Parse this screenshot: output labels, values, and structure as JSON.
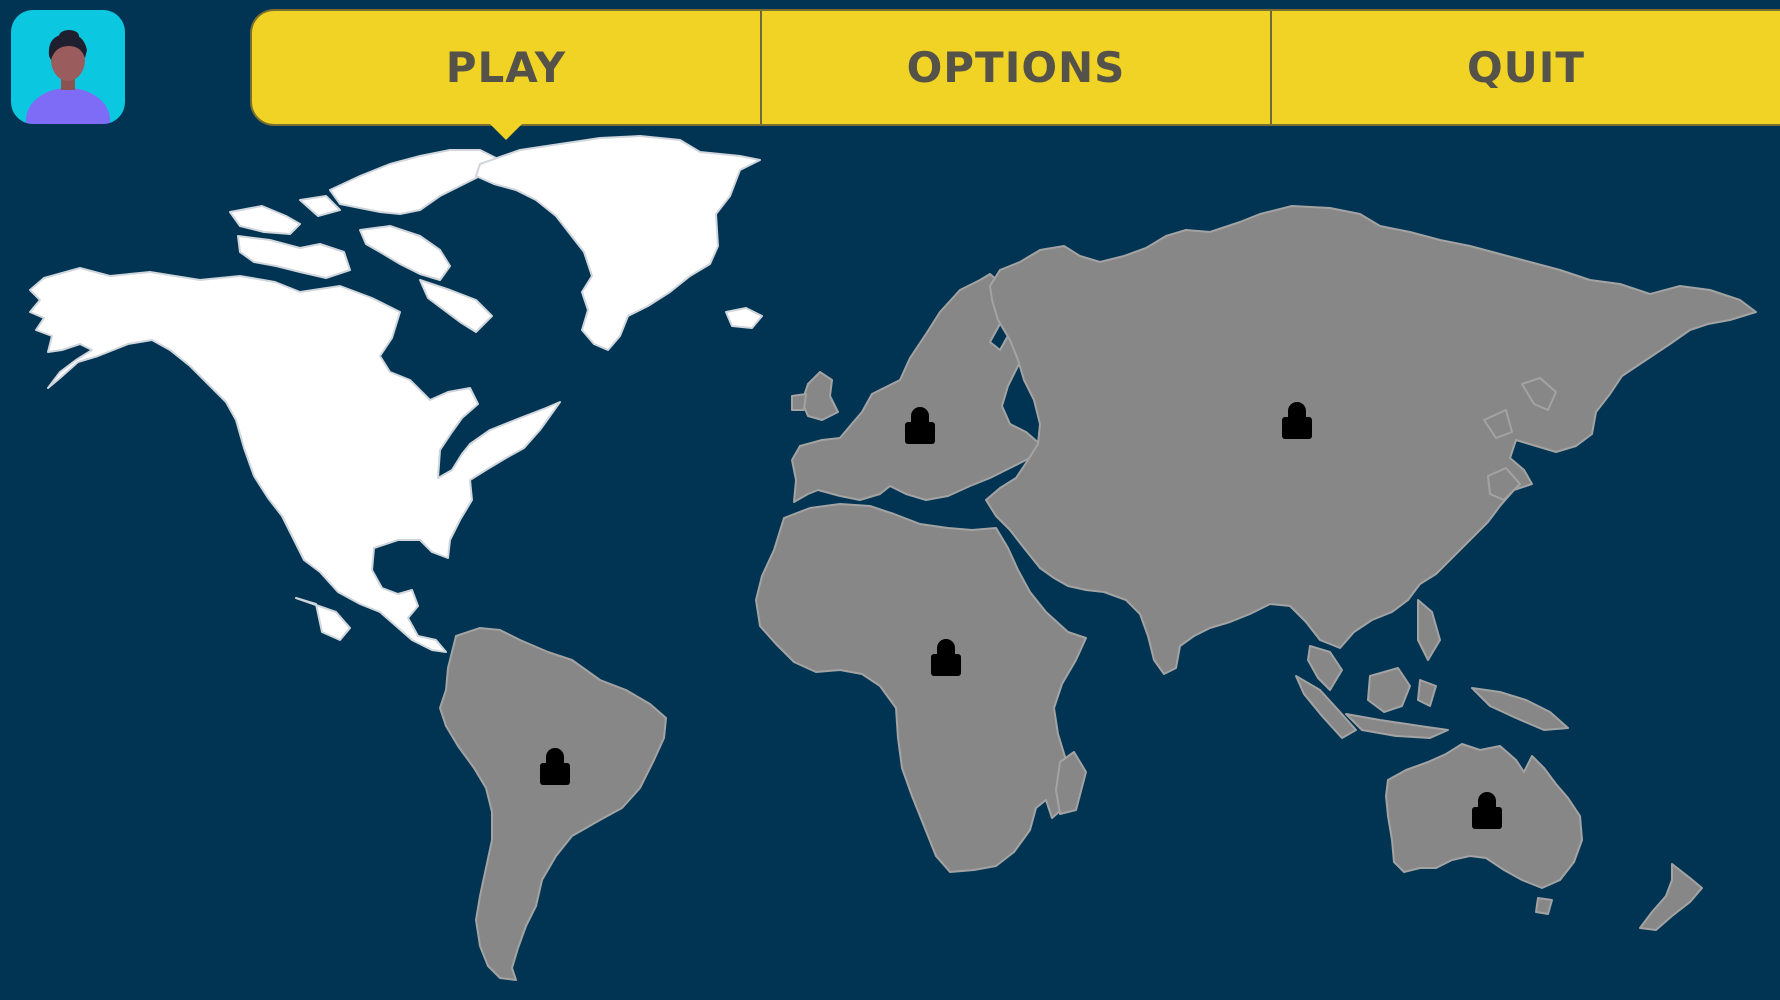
{
  "menu": {
    "play_label": "PLAY",
    "options_label": "OPTIONS",
    "quit_label": "QUIT",
    "active_tab": "PLAY"
  },
  "avatar": {
    "icon": "player-avatar-icon",
    "background_color": "#0bc8e0"
  },
  "map": {
    "continents": [
      {
        "id": "north-america",
        "status": "unlocked"
      },
      {
        "id": "south-america",
        "status": "locked",
        "icon": "lock-icon"
      },
      {
        "id": "europe",
        "status": "locked",
        "icon": "lock-icon"
      },
      {
        "id": "africa",
        "status": "locked",
        "icon": "lock-icon"
      },
      {
        "id": "asia",
        "status": "locked",
        "icon": "lock-icon"
      },
      {
        "id": "australia",
        "status": "locked",
        "icon": "lock-icon"
      }
    ]
  },
  "colors": {
    "background": "#013452",
    "menu": "#f0d324",
    "menu_text": "#55524a",
    "unlocked": "#ffffff",
    "locked": "#878787",
    "lock_icon": "#5b5b5b"
  }
}
